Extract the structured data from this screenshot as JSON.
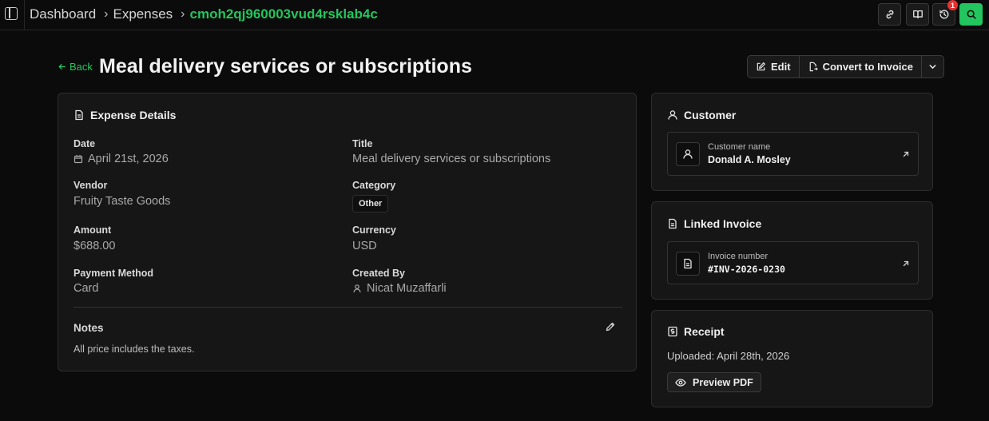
{
  "breadcrumb": {
    "items": [
      "Dashboard",
      "Expenses"
    ],
    "current": "cmoh2qj960003vud4rsklab4c",
    "separator": "›"
  },
  "toolbar": {
    "notification_count": "1",
    "icons": [
      "link-icon",
      "book-icon",
      "history-icon",
      "search-icon"
    ]
  },
  "header": {
    "back_label": "Back",
    "title": "Meal delivery services or subscriptions",
    "edit_label": "Edit",
    "convert_label": "Convert to Invoice"
  },
  "details": {
    "title": "Expense Details",
    "date_label": "Date",
    "date_value": "April 21st, 2026",
    "title_label": "Title",
    "title_value": "Meal delivery services or subscriptions",
    "vendor_label": "Vendor",
    "vendor_value": "Fruity Taste Goods",
    "category_label": "Category",
    "category_value": "Other",
    "amount_label": "Amount",
    "amount_value": "$688.00",
    "currency_label": "Currency",
    "currency_value": "USD",
    "payment_label": "Payment Method",
    "payment_value": "Card",
    "created_label": "Created By",
    "created_value": "Nicat Muzaffarli",
    "notes_label": "Notes",
    "notes_text": "All price includes the taxes."
  },
  "customer": {
    "title": "Customer",
    "label": "Customer name",
    "value": "Donald A. Mosley"
  },
  "invoice": {
    "title": "Linked Invoice",
    "label": "Invoice number",
    "value": "#INV-2026-0230"
  },
  "receipt": {
    "title": "Receipt",
    "uploaded": "Uploaded: April 28th, 2026",
    "preview_label": "Preview PDF"
  },
  "colors": {
    "accent": "#22c55e",
    "background": "#0b0b0b",
    "card": "#161616",
    "badge": "#e5312f"
  }
}
